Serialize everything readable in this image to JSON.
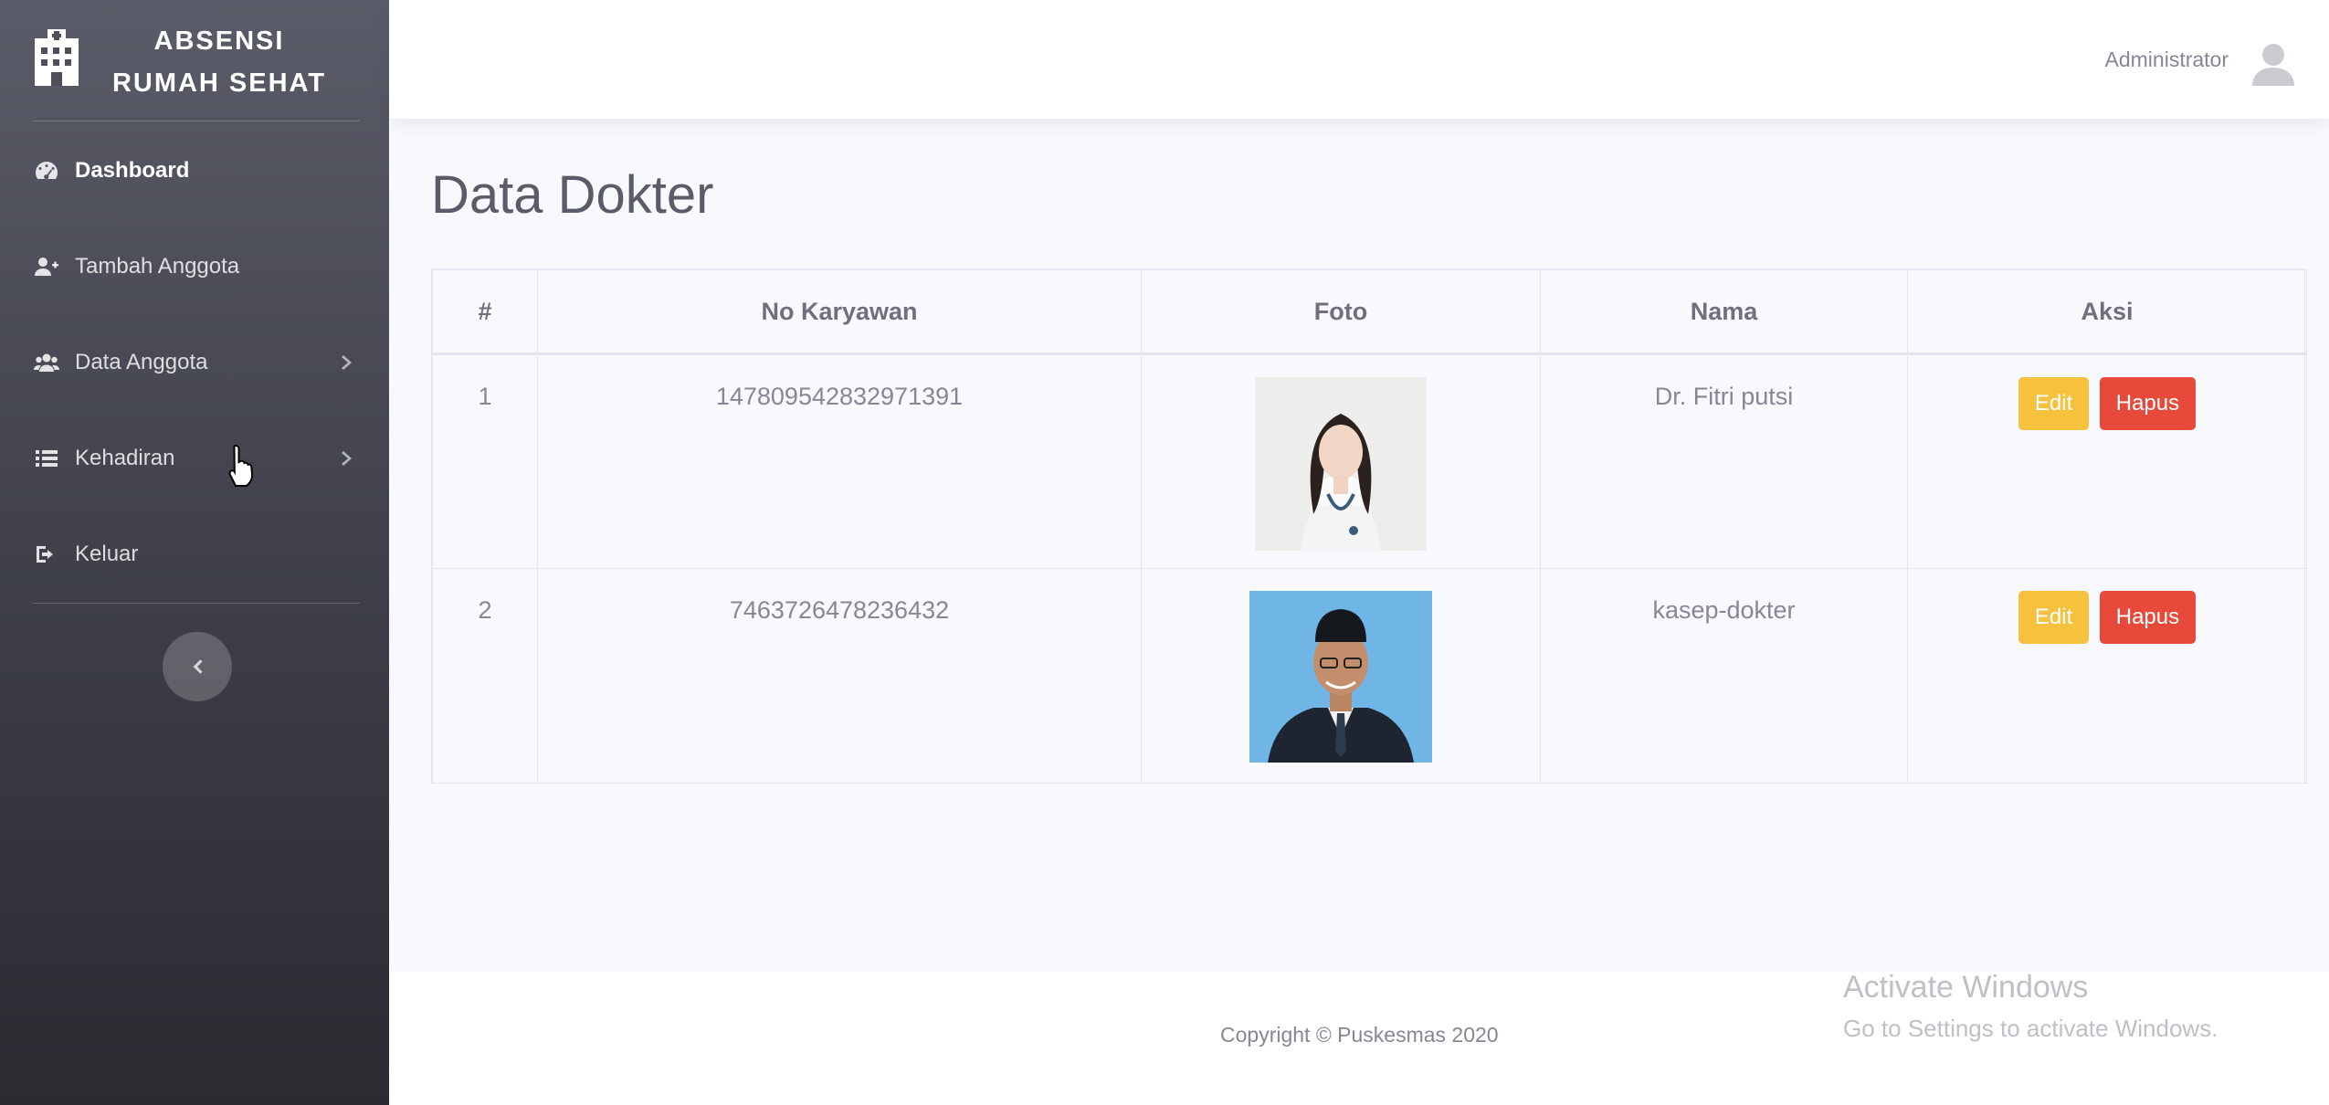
{
  "brand": {
    "line1": "ABSENSI",
    "line2": "RUMAH SEHAT"
  },
  "sidebar": {
    "items": [
      {
        "label": "Dashboard",
        "icon": "tachometer-icon"
      },
      {
        "label": "Tambah Anggota",
        "icon": "user-plus-icon"
      },
      {
        "label": "Data Anggota",
        "icon": "users-icon"
      },
      {
        "label": "Kehadiran",
        "icon": "list-icon"
      },
      {
        "label": "Keluar",
        "icon": "sign-out-icon"
      }
    ]
  },
  "topbar": {
    "user_name": "Administrator"
  },
  "page": {
    "title": "Data Dokter"
  },
  "table": {
    "headers": [
      "#",
      "No Karyawan",
      "Foto",
      "Nama",
      "Aksi"
    ],
    "rows": [
      {
        "no": "1",
        "no_karyawan": "147809542832971391",
        "nama": "Dr. Fitri putsi",
        "edit": "Edit",
        "hapus": "Hapus"
      },
      {
        "no": "2",
        "no_karyawan": "7463726478236432",
        "nama": "kasep-dokter",
        "edit": "Edit",
        "hapus": "Hapus"
      }
    ]
  },
  "footer": {
    "copyright": "Copyright © Puskesmas 2020"
  },
  "watermark": {
    "title": "Activate Windows",
    "subtitle": "Go to Settings to activate Windows."
  },
  "colors": {
    "edit": "#f6c23e",
    "delete": "#e74a3b",
    "sidebar": "#4e4f58"
  }
}
